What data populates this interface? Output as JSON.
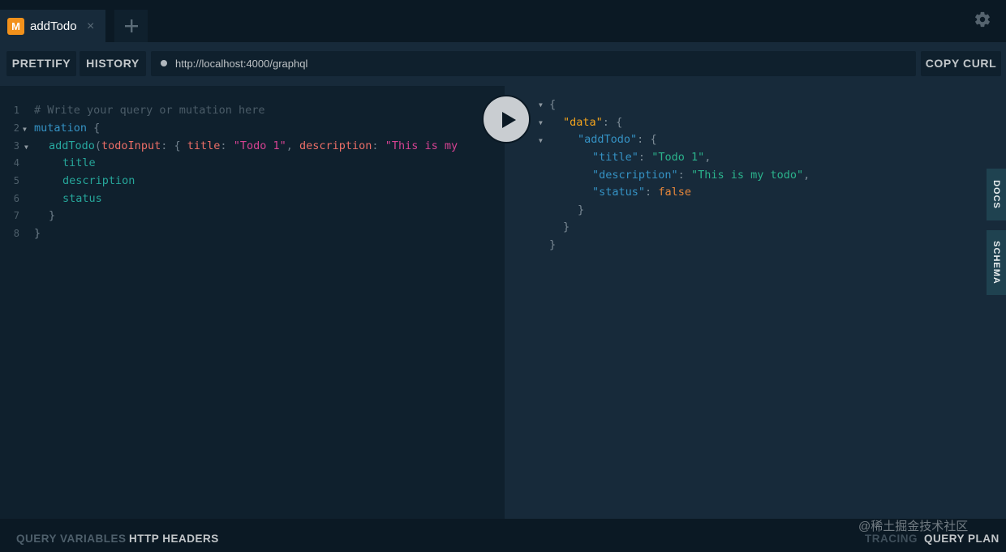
{
  "tab": {
    "badge": "M",
    "title": "addTodo",
    "close": "×"
  },
  "toolbar": {
    "prettify": "PRETTIFY",
    "history": "HISTORY",
    "url": "http://localhost:4000/graphql",
    "copy_curl": "COPY CURL"
  },
  "editor": {
    "line_numbers": [
      "1",
      "2",
      "3",
      "4",
      "5",
      "6",
      "7",
      "8"
    ],
    "lines": {
      "l1": "# Write your query or mutation here",
      "l2_kw": "mutation",
      "l2_brace": "{",
      "l3_fn": "addTodo",
      "l3_open": "(",
      "l3_arg": "todoInput",
      "l3_colon": ":",
      "l3_brace": "{",
      "l3_title_key": "title",
      "l3_title_colon": ":",
      "l3_title_val": "\"Todo 1\"",
      "l3_comma": ",",
      "l3_desc_key": "description",
      "l3_desc_colon": ":",
      "l3_desc_val": "\"This is my",
      "l4": "title",
      "l5": "description",
      "l6": "status",
      "l7": "}",
      "l8": "}"
    }
  },
  "result": {
    "open": "{",
    "data_key": "\"data\"",
    "colon1": ":",
    "data_open": "{",
    "addtodo_key": "\"addTodo\"",
    "colon2": ":",
    "addtodo_open": "{",
    "title_key": "\"title\"",
    "title_colon": ":",
    "title_val": "\"Todo 1\"",
    "title_comma": ",",
    "desc_key": "\"description\"",
    "desc_colon": ":",
    "desc_val": "\"This is my todo\"",
    "desc_comma": ",",
    "status_key": "\"status\"",
    "status_colon": ":",
    "status_val": "false",
    "close3": "}",
    "close2": "}",
    "close1": "}"
  },
  "side_tabs": {
    "docs": "DOCS",
    "schema": "SCHEMA"
  },
  "bottom": {
    "query_variables": "QUERY VARIABLES",
    "http_headers": "HTTP HEADERS",
    "tracing": "TRACING",
    "query_plan": "QUERY PLAN"
  },
  "watermark": "@稀土掘金技术社区",
  "icons": {
    "settings": "gear-icon",
    "add_tab": "plus-icon",
    "run": "play-icon"
  }
}
